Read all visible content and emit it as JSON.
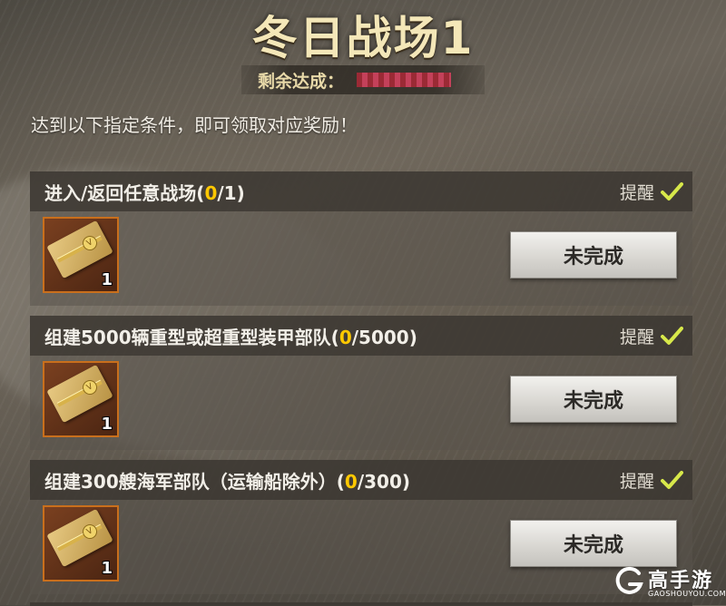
{
  "event": {
    "title": "冬日战场1",
    "remaining_label": "剩余达成：",
    "instruction": "达到以下指定条件，即可领取对应奖励！"
  },
  "tasks": [
    {
      "name_prefix": "进入/返回任意战场(",
      "progress_current": "0",
      "progress_suffix": "/1)",
      "reminder_label": "提醒",
      "reminder_checked": true,
      "reward_icon": "ticket-icon",
      "reward_count": "1",
      "status_label": "未完成"
    },
    {
      "name_prefix": "组建5000辆重型或超重型装甲部队(",
      "progress_current": "0",
      "progress_suffix": "/5000)",
      "reminder_label": "提醒",
      "reminder_checked": true,
      "reward_icon": "ticket-icon",
      "reward_count": "1",
      "status_label": "未完成"
    },
    {
      "name_prefix": "组建300艘海军部队（运输船除外）(",
      "progress_current": "0",
      "progress_suffix": "/300)",
      "reminder_label": "提醒",
      "reminder_checked": true,
      "reward_icon": "ticket-icon",
      "reward_count": "1",
      "status_label": "未完成"
    }
  ],
  "colors": {
    "progress_highlight": "#ffc800",
    "checkmark": "#d7e84a",
    "reward_border": "#c96f1c"
  },
  "watermark": {
    "name": "高手游",
    "domain": "GAOSHOUYOU.COM"
  }
}
